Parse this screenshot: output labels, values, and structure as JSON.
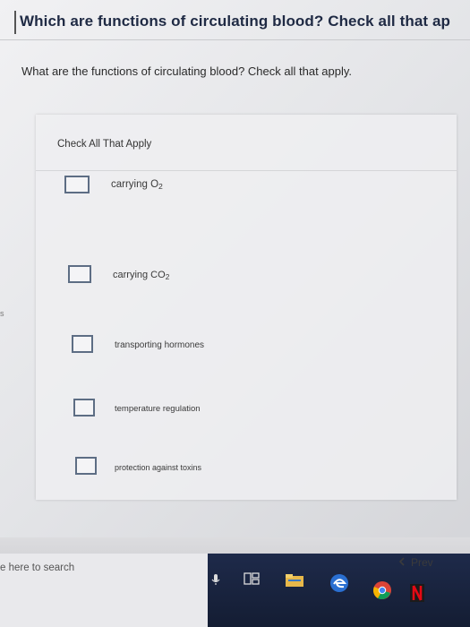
{
  "header": {
    "title": "Which are functions of circulating blood? Check all that ap"
  },
  "question": {
    "text": "What are the functions of circulating blood? Check all that apply."
  },
  "card": {
    "header": "Check All That Apply"
  },
  "options": [
    {
      "label": "carrying O",
      "subscript": "2",
      "checked": false
    },
    {
      "label": "carrying CO",
      "subscript": "2",
      "checked": false
    },
    {
      "label": "transporting hormones",
      "subscript": "",
      "checked": false
    },
    {
      "label": "temperature regulation",
      "subscript": "",
      "checked": false
    },
    {
      "label": "protection against toxins",
      "subscript": "",
      "checked": false
    }
  ],
  "navigation": {
    "prev_label": "Prev",
    "prev_icon": "chevron-left-icon"
  },
  "taskbar": {
    "search_placeholder": "e here to search",
    "icons": [
      "microphone-icon",
      "task-view-icon",
      "file-explorer-icon",
      "edge-icon",
      "chrome-icon",
      "netflix-icon"
    ]
  },
  "colors": {
    "heading": "#1f2a44",
    "checkbox_border": "#5d6d84",
    "taskbar": "#1e2a4a"
  }
}
